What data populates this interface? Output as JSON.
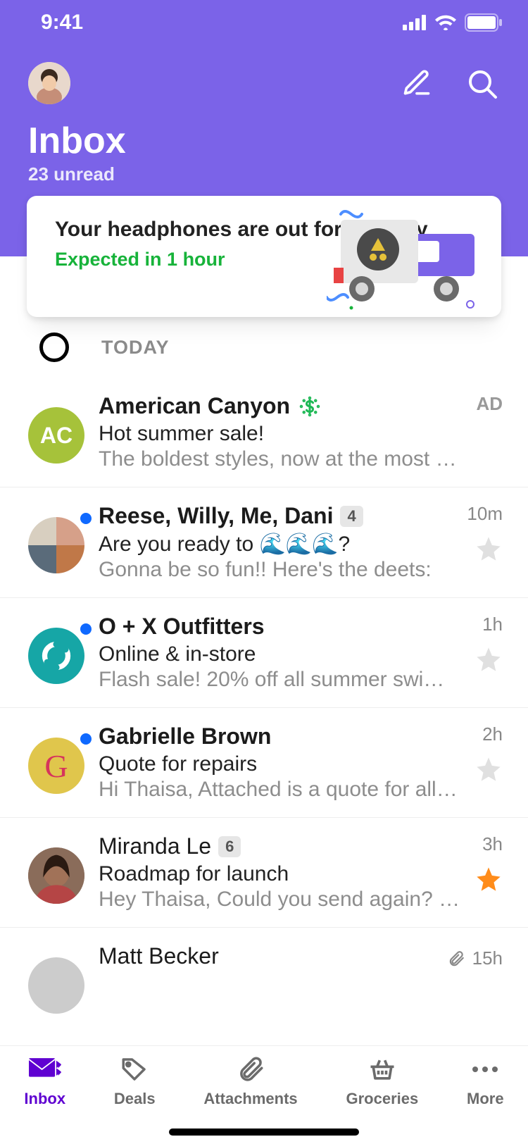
{
  "status": {
    "time": "9:41"
  },
  "header": {
    "title": "Inbox",
    "subtitle": "23 unread"
  },
  "delivery": {
    "line1": "Your headphones are out for delivery",
    "eta": "Expected in 1 hour"
  },
  "section": {
    "label": "TODAY"
  },
  "emails": [
    {
      "sender": "American Canyon",
      "subject": "Hot summer sale!",
      "snippet": "The boldest styles, now at the most adven…",
      "time": "",
      "ad": "AD",
      "unread": false,
      "avatar_bg": "#a6c23a",
      "avatar_text": "AC"
    },
    {
      "sender": "Reese, Willy, Me, Dani",
      "count": "4",
      "subject": "Are you ready to  🌊🌊🌊?",
      "snippet": "Gonna be so fun!! Here's the deets:",
      "time": "10m",
      "unread": true,
      "starred": false
    },
    {
      "sender": "O + X Outfitters",
      "subject": "Online & in-store",
      "snippet": "Flash sale! 20% off all summer swim…",
      "time": "1h",
      "unread": true,
      "starred": false,
      "avatar_bg": "#16a6a6"
    },
    {
      "sender": "Gabrielle Brown",
      "subject": "Quote for repairs",
      "snippet": "Hi Thaisa, Attached is a quote for all …",
      "time": "2h",
      "unread": true,
      "starred": false,
      "avatar_bg": "#e0c64c"
    },
    {
      "sender": "Miranda Le",
      "count": "6",
      "subject": "Roadmap for launch",
      "snippet": "Hey Thaisa, Could you send again? I …",
      "time": "3h",
      "unread": false,
      "starred": true,
      "avatar_bg": "#7a5c4e"
    },
    {
      "sender": "Matt Becker",
      "subject": "",
      "snippet": "",
      "time": "15h",
      "unread": false,
      "has_attachment": true
    }
  ],
  "nav": {
    "inbox": "Inbox",
    "deals": "Deals",
    "attachments": "Attachments",
    "groceries": "Groceries",
    "more": "More"
  }
}
